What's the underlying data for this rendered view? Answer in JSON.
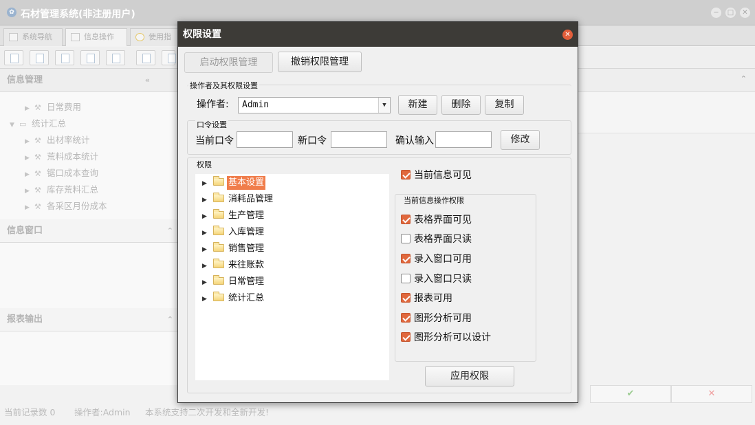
{
  "app": {
    "title": "石材管理系统(非注册用户)",
    "tabs": [
      "系统导航",
      "信息操作",
      "使用指南"
    ],
    "left_panels": {
      "info_mgmt": "信息管理",
      "info_window": "信息窗口",
      "report_output": "报表输出"
    },
    "tree": [
      {
        "label": "日常费用",
        "depth": 1,
        "type": "leaf"
      },
      {
        "label": "统计汇总",
        "depth": 0,
        "type": "folder"
      },
      {
        "label": "出材率统计",
        "depth": 1,
        "type": "leaf"
      },
      {
        "label": "荒料成本统计",
        "depth": 1,
        "type": "leaf"
      },
      {
        "label": "锯口成本查询",
        "depth": 1,
        "type": "leaf"
      },
      {
        "label": "库存荒料汇总",
        "depth": 1,
        "type": "leaf"
      },
      {
        "label": "各采区月份成本",
        "depth": 1,
        "type": "leaf"
      }
    ],
    "status": {
      "records": "当前记录数 0",
      "operator": "操作者:Admin",
      "notice": "本系统支持二次开发和全新开发!"
    },
    "bottom_buttons": [
      "✔",
      "✕"
    ]
  },
  "dialog": {
    "title": "权限设置",
    "enable_btn": "启动权限管理",
    "revoke_btn": "撤销权限管理",
    "operator_group": {
      "title": "操作者及其权限设置",
      "label": "操作者:",
      "value": "Admin",
      "new_btn": "新建",
      "delete_btn": "删除",
      "copy_btn": "复制"
    },
    "password_group": {
      "title": "口令设置",
      "current_label": "当前口令",
      "new_label": "新口令",
      "confirm_label": "确认输入",
      "modify_btn": "修改"
    },
    "perm_group": {
      "title": "权限",
      "tree": [
        {
          "label": "基本设置",
          "selected": true
        },
        {
          "label": "消耗品管理",
          "selected": false
        },
        {
          "label": "生产管理",
          "selected": false
        },
        {
          "label": "入库管理",
          "selected": false
        },
        {
          "label": "销售管理",
          "selected": false
        },
        {
          "label": "来往账款",
          "selected": false
        },
        {
          "label": "日常管理",
          "selected": false
        },
        {
          "label": "统计汇总",
          "selected": false
        }
      ],
      "visible": {
        "label": "当前信息可见",
        "checked": true
      },
      "ops_title": "当前信息操作权限",
      "ops": [
        {
          "label": "表格界面可见",
          "checked": true
        },
        {
          "label": "表格界面只读",
          "checked": false
        },
        {
          "label": "录入窗口可用",
          "checked": true
        },
        {
          "label": "录入窗口只读",
          "checked": false
        },
        {
          "label": "报表可用",
          "checked": true
        },
        {
          "label": "图形分析可用",
          "checked": true
        },
        {
          "label": "图形分析可以设计",
          "checked": true
        }
      ],
      "apply_btn": "应用权限"
    }
  },
  "colors": {
    "dialog_title_bg": "#3d3b37",
    "close_btn": "#e35e3b",
    "check_accent": "#e0683d",
    "selection": "#f07d4b"
  }
}
